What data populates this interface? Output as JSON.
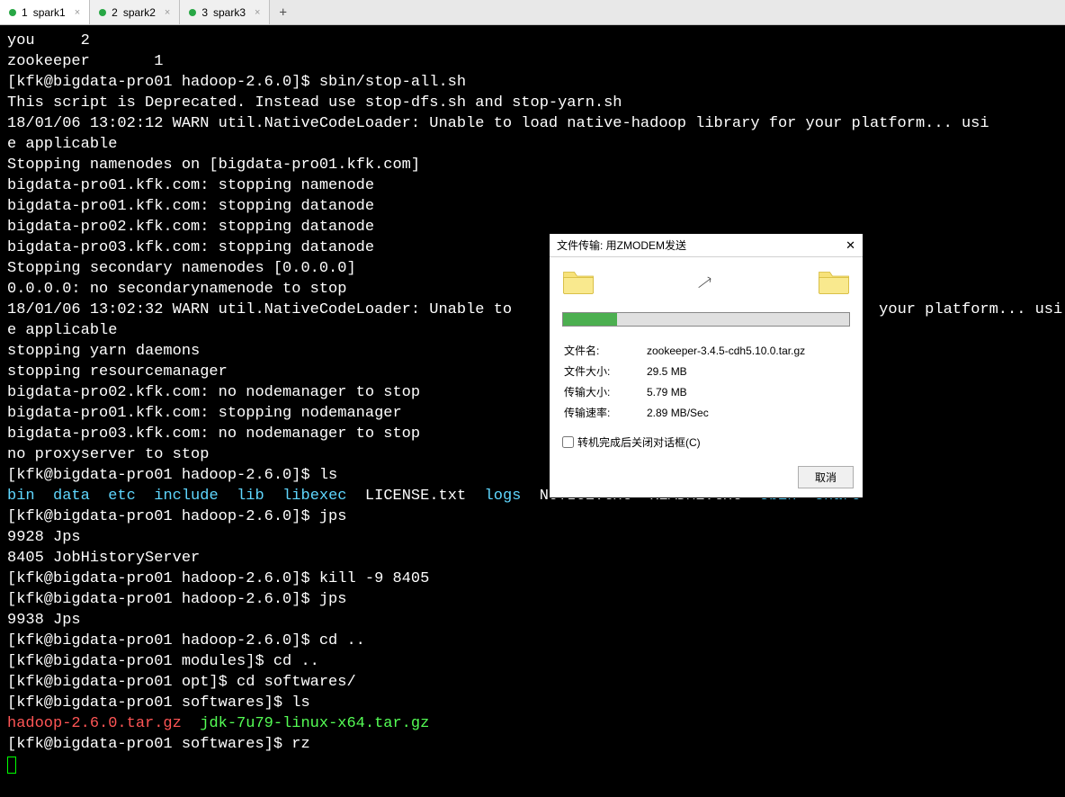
{
  "tabs": [
    {
      "index": "1",
      "label": "spark1",
      "active": true
    },
    {
      "index": "2",
      "label": "spark2",
      "active": false
    },
    {
      "index": "3",
      "label": "spark3",
      "active": false
    }
  ],
  "terminal": {
    "l0": "you     2",
    "l1": "zookeeper       1",
    "l2": "[kfk@bigdata-pro01 hadoop-2.6.0]$ sbin/stop-all.sh",
    "l3": "This script is Deprecated. Instead use stop-dfs.sh and stop-yarn.sh",
    "l4": "18/01/06 13:02:12 WARN util.NativeCodeLoader: Unable to load native-hadoop library for your platform... usi",
    "l5": "e applicable",
    "l6": "Stopping namenodes on [bigdata-pro01.kfk.com]",
    "l7": "bigdata-pro01.kfk.com: stopping namenode",
    "l8": "bigdata-pro01.kfk.com: stopping datanode",
    "l9": "bigdata-pro02.kfk.com: stopping datanode",
    "l10": "bigdata-pro03.kfk.com: stopping datanode",
    "l11": "Stopping secondary namenodes [0.0.0.0]",
    "l12": "0.0.0.0: no secondarynamenode to stop",
    "l13a": "18/01/06 13:02:32 WARN util.NativeCodeLoader: Unable to",
    "l13b": "your platform... usi",
    "l14": "e applicable",
    "l15": "stopping yarn daemons",
    "l16": "stopping resourcemanager",
    "l17": "bigdata-pro02.kfk.com: no nodemanager to stop",
    "l18": "bigdata-pro01.kfk.com: stopping nodemanager",
    "l19": "bigdata-pro03.kfk.com: no nodemanager to stop",
    "l20": "no proxyserver to stop",
    "l21": "[kfk@bigdata-pro01 hadoop-2.6.0]$ ls",
    "ls": {
      "bin": "bin",
      "data": "data",
      "etc": "etc",
      "include": "include",
      "lib": "lib",
      "libexec": "libexec",
      "license": "LICENSE.txt",
      "logs": "logs",
      "notice": "NOTICE.txt",
      "readme": "README.txt",
      "sbin": "sbin",
      "share": "share"
    },
    "l23": "[kfk@bigdata-pro01 hadoop-2.6.0]$ jps",
    "l24": "9928 Jps",
    "l25": "8405 JobHistoryServer",
    "l26": "[kfk@bigdata-pro01 hadoop-2.6.0]$ kill -9 8405",
    "l27": "[kfk@bigdata-pro01 hadoop-2.6.0]$ jps",
    "l28": "9938 Jps",
    "l29": "[kfk@bigdata-pro01 hadoop-2.6.0]$ cd ..",
    "l30": "[kfk@bigdata-pro01 modules]$ cd ..",
    "l31": "[kfk@bigdata-pro01 opt]$ cd softwares/",
    "l32": "[kfk@bigdata-pro01 softwares]$ ls",
    "ls2": {
      "hadoop": "hadoop-2.6.0.tar.gz",
      "jdk": "jdk-7u79-linux-x64.tar.gz"
    },
    "l34": "[kfk@bigdata-pro01 softwares]$ rz"
  },
  "dialog": {
    "title": "文件传输: 用ZMODEM发送",
    "progress_percent": 19,
    "rows": {
      "filename_label": "文件名:",
      "filename_value": "zookeeper-3.4.5-cdh5.10.0.tar.gz",
      "filesize_label": "文件大小:",
      "filesize_value": "29.5 MB",
      "transfersize_label": "传输大小:",
      "transfersize_value": "5.79 MB",
      "rate_label": "传输速率:",
      "rate_value": "2.89 MB/Sec"
    },
    "checkbox_label": "转机完成后关闭对话框(C)",
    "cancel_label": "取消"
  }
}
